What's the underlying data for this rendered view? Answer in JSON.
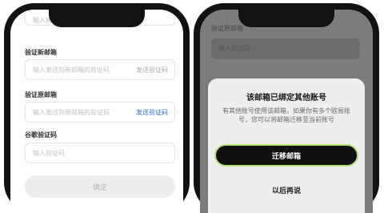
{
  "left": {
    "top_field_placeholder": "输入新邮箱",
    "new_email": {
      "label": "验证新邮箱",
      "placeholder": "输入发送到新邮箱的验证码",
      "send_label": "发送验证码"
    },
    "old_email": {
      "label": "验证原邮箱",
      "placeholder": "输入发送到原邮箱的验证码",
      "send_label": "发送验证码"
    },
    "google_code": {
      "label": "谷歌验证码",
      "placeholder": "输入验证码"
    },
    "confirm_label": "确定",
    "colors": {
      "send_disabled": "#a8a8a8",
      "send_active": "#2f6fda"
    }
  },
  "right": {
    "bg_label": "验证原邮箱",
    "bg_placeholder": "输入验证码",
    "sheet": {
      "title": "该邮箱已绑定其他账号",
      "description": "有其他账号使用该邮箱，如果你有多个欧易账号，您可以将邮箱迁移至当前账号",
      "migrate_label": "迁移邮箱",
      "later_label": "以后再说"
    },
    "colors": {
      "accent_border": "#b6e27a"
    }
  }
}
